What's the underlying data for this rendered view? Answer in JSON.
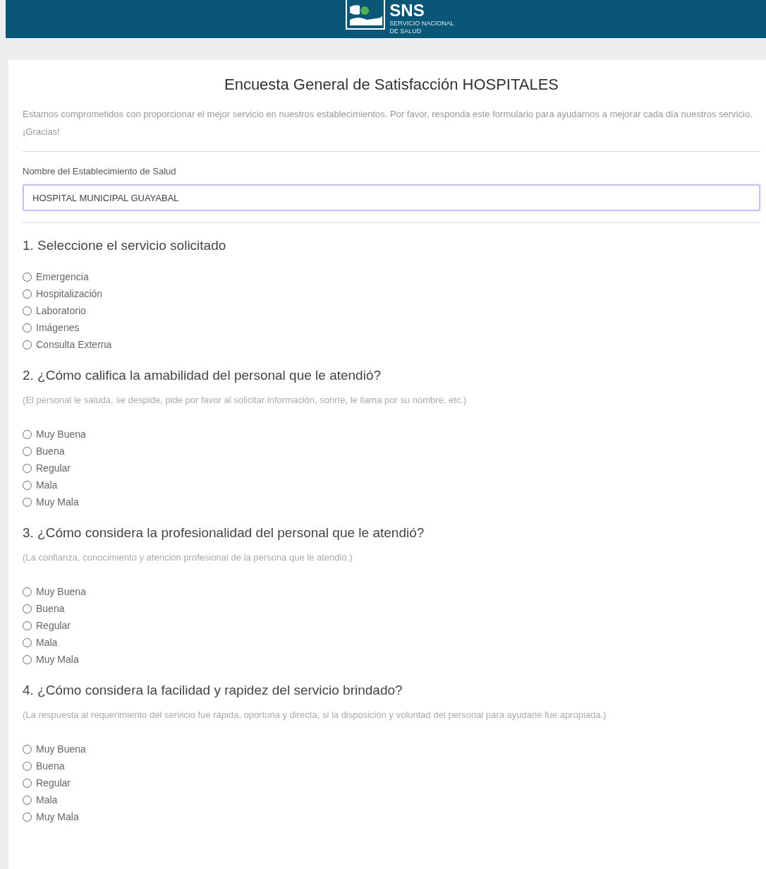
{
  "header": {
    "logo": {
      "name": "SNS",
      "lines": [
        "SERVICIO NACIONAL",
        "DE SALUD"
      ]
    }
  },
  "form": {
    "title": "Encuesta General de Satisfacción HOSPITALES",
    "intro": "Estamos comprometidos con proporcionar el mejor servicio en nuestros establecimientos. Por favor, responda este formulario para ayudarnos a mejorar cada día nuestros servicio. ¡Gracias!",
    "field": {
      "label": "Nombre del Establecimiento de Salud",
      "value": "HOSPITAL MUNICIPAL GUAYABAL",
      "focused": true
    },
    "questions": [
      {
        "title": "1. Seleccione el servicio solicitado",
        "options": [
          {
            "label": "Emergencia",
            "selected": false
          },
          {
            "label": "Hospitalización",
            "selected": false
          },
          {
            "label": "Laboratorio",
            "selected": false
          },
          {
            "label": "Imágenes",
            "selected": false
          },
          {
            "label": "Consulta Externa",
            "selected": false
          }
        ]
      },
      {
        "title": "2. ¿Cómo califica la amabilidad del personal que le atendió?",
        "hint": "(El personal le saluda, se despide, pide por favor al solicitar información, sonríe, le llama por su nombre, etc.)",
        "options": [
          {
            "label": "Muy Buena",
            "selected": false
          },
          {
            "label": "Buena",
            "selected": false
          },
          {
            "label": "Regular",
            "selected": false
          },
          {
            "label": "Mala",
            "selected": false
          },
          {
            "label": "Muy Mala",
            "selected": false
          }
        ]
      },
      {
        "title": "3. ¿Cómo considera la profesionalidad del personal que le atendió?",
        "hint": "(La confianza, conocimiento y atención profesional de la persona que le atendió.)",
        "options": [
          {
            "label": "Muy Buena",
            "selected": false
          },
          {
            "label": "Buena",
            "selected": false
          },
          {
            "label": "Regular",
            "selected": false
          },
          {
            "label": "Mala",
            "selected": false
          },
          {
            "label": "Muy Mala",
            "selected": false
          }
        ]
      },
      {
        "title": "4. ¿Cómo considera la facilidad y rapidez del servicio brindado?",
        "hint": "(La respuesta al requerimiento del servicio fue rápida, oportuna y directa, si la disposición y voluntad del personal para ayudarle fue apropiada.)",
        "options": [
          {
            "label": "Muy Buena",
            "selected": false
          },
          {
            "label": "Buena",
            "selected": false
          },
          {
            "label": "Regular",
            "selected": false
          },
          {
            "label": "Mala",
            "selected": false
          },
          {
            "label": "Muy Mala",
            "selected": false
          }
        ]
      }
    ]
  }
}
